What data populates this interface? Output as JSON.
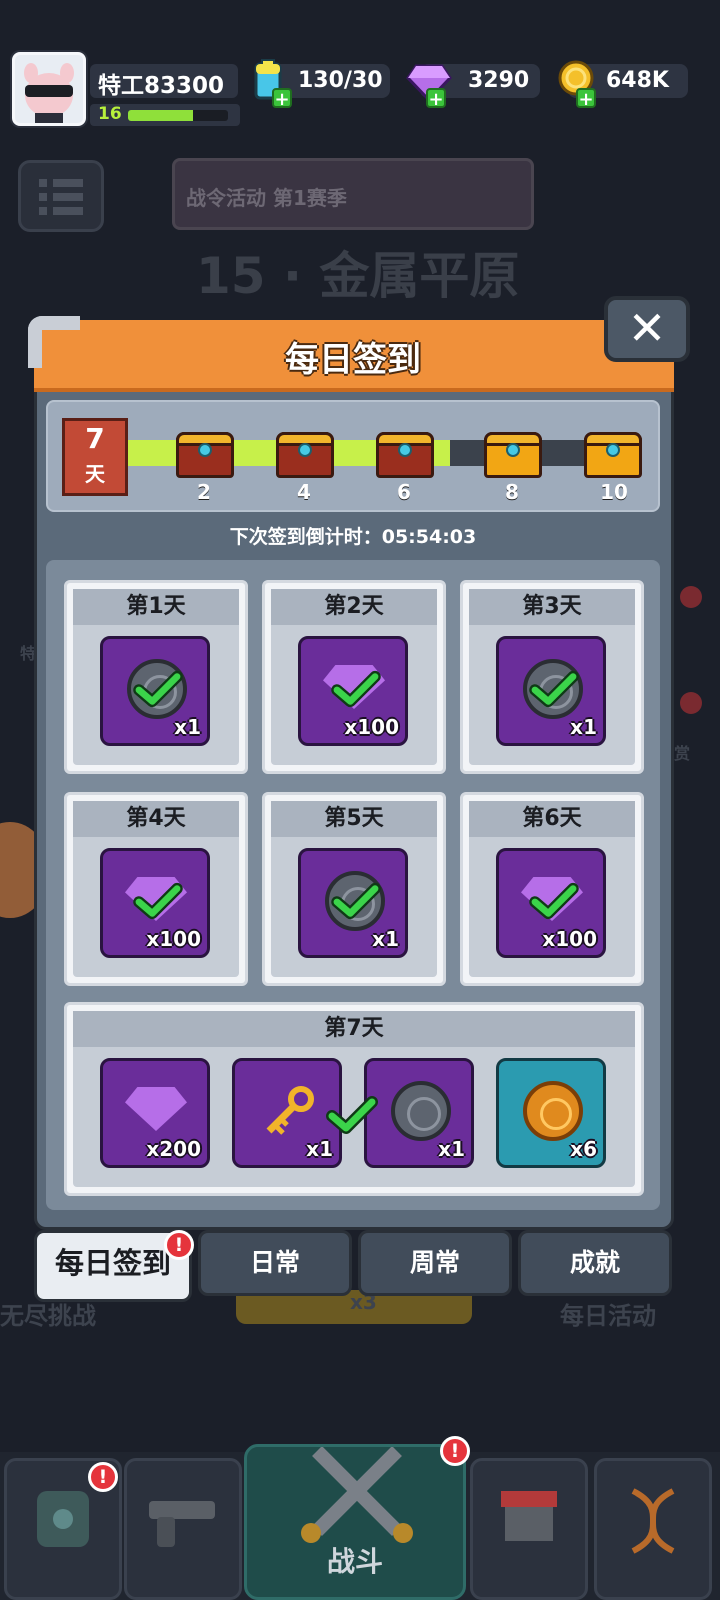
{
  "hud": {
    "player_name": "特工83300",
    "level": "16",
    "xp_progress": 0.65,
    "energy": "130/30",
    "gems": "3290",
    "gold": "648K"
  },
  "background": {
    "battle_pass": "战令活动 第1赛季",
    "stage": "15 · 金属平原",
    "left_text": "特",
    "right_text": "赏",
    "endless": "无尽挑战",
    "daily_event": "每日活动",
    "under_count": "x3"
  },
  "modal": {
    "title": "每日签到",
    "close_label": "✕",
    "progress": {
      "current_day": "7",
      "day_unit": "天",
      "fill_fraction": 0.66,
      "milestones": [
        {
          "label": "2",
          "state": "opened"
        },
        {
          "label": "4",
          "state": "opened"
        },
        {
          "label": "6",
          "state": "opened"
        },
        {
          "label": "8",
          "state": "closed"
        },
        {
          "label": "10",
          "state": "closed"
        }
      ]
    },
    "countdown": "下次签到倒计时：05:54:03",
    "days": [
      {
        "label": "第1天",
        "reward": "coin",
        "qty": "x1",
        "claimed": true
      },
      {
        "label": "第2天",
        "reward": "gem",
        "qty": "x100",
        "claimed": true
      },
      {
        "label": "第3天",
        "reward": "coin",
        "qty": "x1",
        "claimed": true
      },
      {
        "label": "第4天",
        "reward": "gem",
        "qty": "x100",
        "claimed": true
      },
      {
        "label": "第5天",
        "reward": "coin",
        "qty": "x1",
        "claimed": true
      },
      {
        "label": "第6天",
        "reward": "gem",
        "qty": "x100",
        "claimed": true
      }
    ],
    "day7": {
      "label": "第7天",
      "rewards": [
        {
          "reward": "gem",
          "qty": "x200"
        },
        {
          "reward": "key",
          "qty": "x1"
        },
        {
          "reward": "winged-coin",
          "qty": "x1"
        },
        {
          "reward": "gold-coin",
          "qty": "x6"
        }
      ]
    }
  },
  "tabs": [
    {
      "label": "每日签到",
      "active": true,
      "badge": "!"
    },
    {
      "label": "日常",
      "active": false
    },
    {
      "label": "周常",
      "active": false
    },
    {
      "label": "成就",
      "active": false
    }
  ],
  "nav": {
    "battle_label": "战斗",
    "badge": "!"
  },
  "colors": {
    "header": "#f0903a",
    "claimed_check": "#3bd44a",
    "progress_fill": "#c7f04a"
  }
}
